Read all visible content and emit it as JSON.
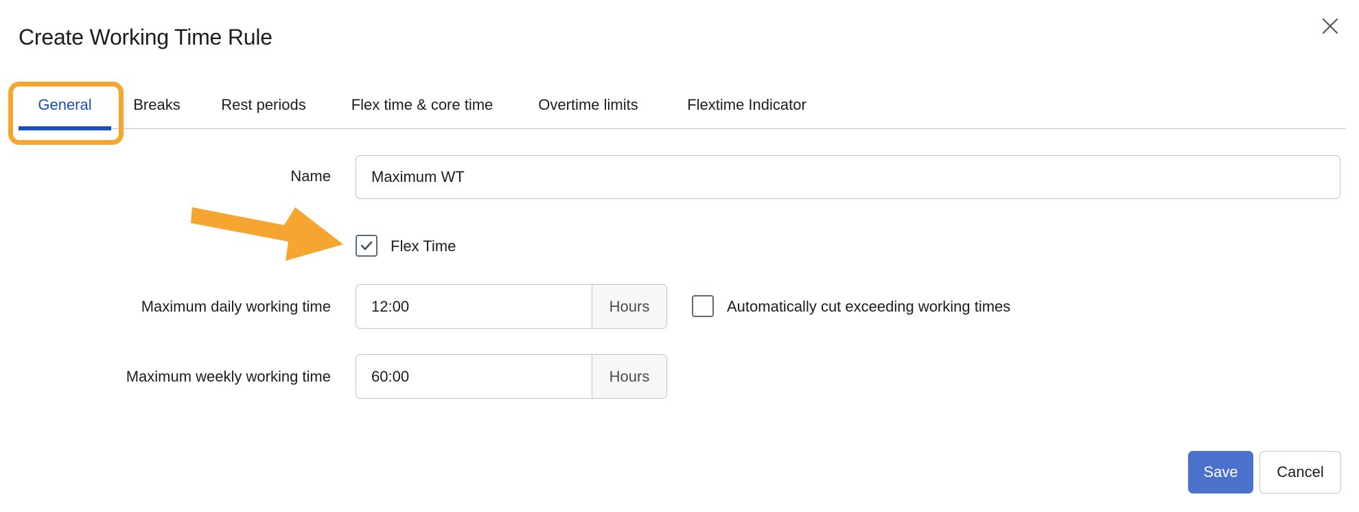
{
  "dialog": {
    "title": "Create Working Time Rule",
    "close_icon": "close-icon"
  },
  "tabs": [
    {
      "label": "General",
      "active": true
    },
    {
      "label": "Breaks"
    },
    {
      "label": "Rest periods"
    },
    {
      "label": "Flex time & core time"
    },
    {
      "label": "Overtime limits"
    },
    {
      "label": "Flextime Indicator"
    }
  ],
  "form": {
    "name_label": "Name",
    "name_value": "Maximum WT",
    "flex_time_label": "Flex Time",
    "flex_time_checked": true,
    "max_daily_label": "Maximum daily working time",
    "max_daily_value": "12:00",
    "max_daily_unit": "Hours",
    "auto_cut_label": "Automatically cut exceeding working times",
    "auto_cut_checked": false,
    "max_weekly_label": "Maximum weekly working time",
    "max_weekly_value": "60:00",
    "max_weekly_unit": "Hours"
  },
  "buttons": {
    "save": "Save",
    "cancel": "Cancel"
  },
  "colors": {
    "accent": "#1c4fb4",
    "highlight": "#f7a531",
    "save_button": "#4a72cc"
  }
}
